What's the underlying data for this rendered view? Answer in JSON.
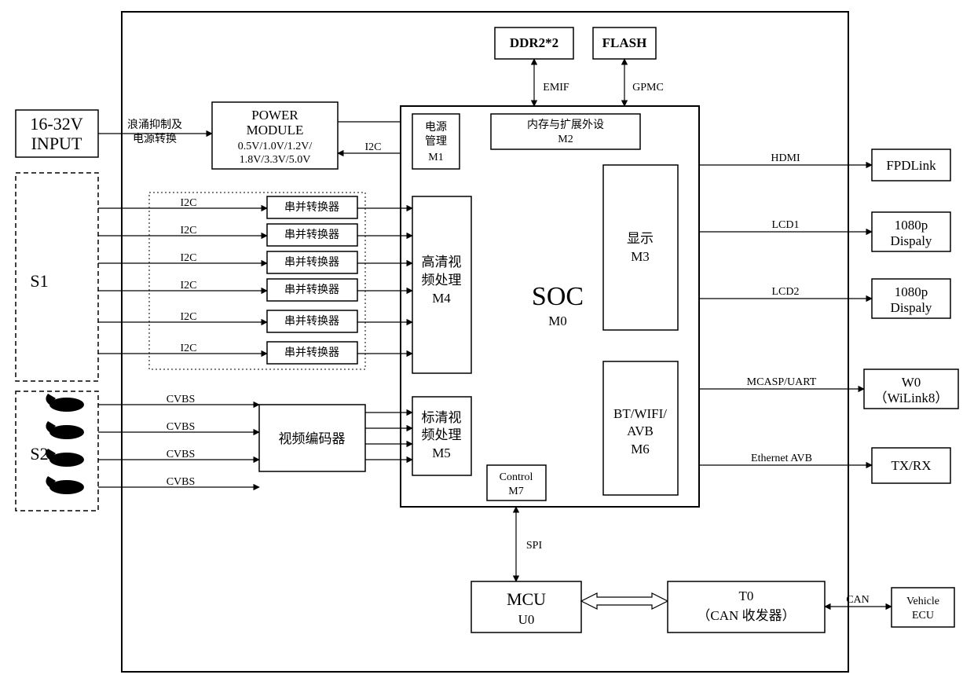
{
  "outer": {
    "id": "system-boundary"
  },
  "input": {
    "line1": "16-32V",
    "line2": "INPUT",
    "surge": "浪涌抑制及\n电源转换"
  },
  "power": {
    "title": "POWER",
    "title2": "MODULE",
    "volts": "0.5V/1.0V/1.2V/\n1.8V/3.3V/5.0V",
    "bus": "I2C"
  },
  "memory": {
    "ddr": "DDR2*2",
    "flash": "FLASH",
    "emif": "EMIF",
    "gpmc": "GPMC"
  },
  "soc": {
    "title": "SOC",
    "id": "M0",
    "m1": {
      "l1": "电源",
      "l2": "管理",
      "id": "M1"
    },
    "m2": {
      "l1": "内存与扩展外设",
      "id": "M2"
    },
    "m3": {
      "l1": "显示",
      "id": "M3"
    },
    "m4": {
      "l1": "高清视",
      "l2": "频处理",
      "id": "M4"
    },
    "m5": {
      "l1": "标清视",
      "l2": "频处理",
      "id": "M5"
    },
    "m6": {
      "l1": "BT/WIFI/",
      "l2": "AVB",
      "id": "M6"
    },
    "m7": {
      "l1": "Control",
      "id": "M7"
    }
  },
  "s1": {
    "label": "S1",
    "i2c": "I2C",
    "conv": "串并转换器"
  },
  "s2": {
    "label": "S2",
    "cvbs": "CVBS",
    "encoder": "视频编码器"
  },
  "right": {
    "hdmi": "HDMI",
    "fpdlink": "FPDLink",
    "lcd1": "LCD1",
    "lcd2": "LCD2",
    "disp_l1": "1080p",
    "disp_l2": "Dispaly",
    "mcasp": "MCASP/UART",
    "w0_l1": "W0",
    "w0_l2": "（WiLink8）",
    "avb": "Ethernet AVB",
    "txrx": "TX/RX"
  },
  "bottom": {
    "spi": "SPI",
    "mcu": "MCU",
    "mcu_id": "U0",
    "t0_l1": "T0",
    "t0_l2": "（CAN 收发器）",
    "can": "CAN",
    "ecu_l1": "Vehicle",
    "ecu_l2": "ECU"
  }
}
